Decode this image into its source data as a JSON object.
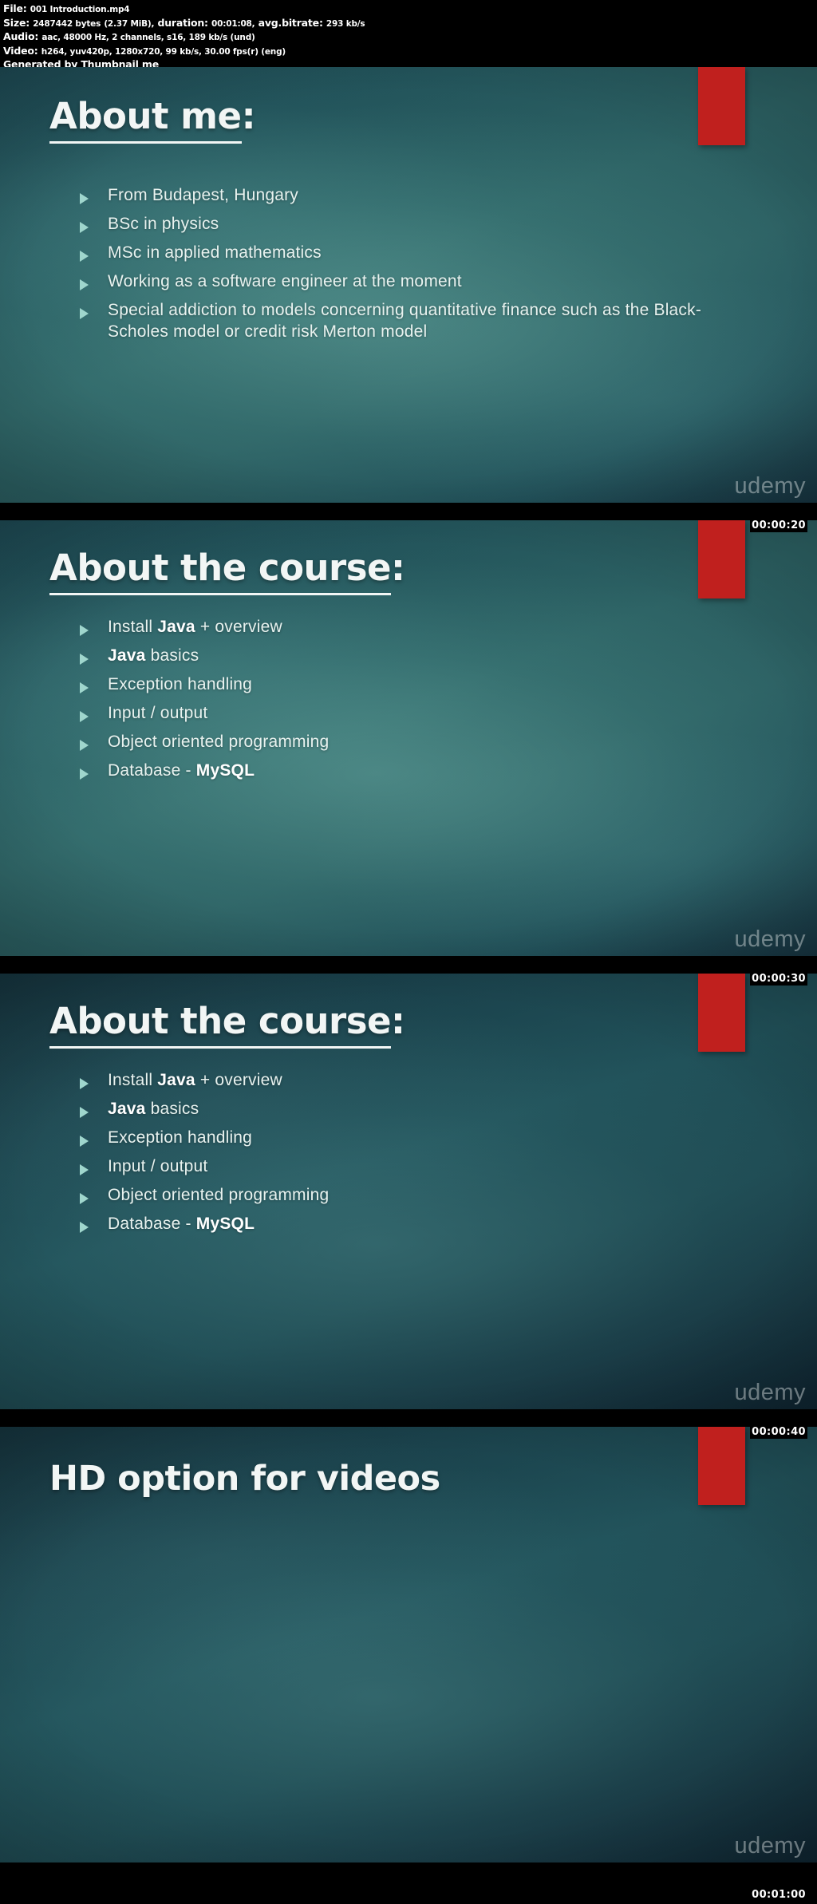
{
  "meta": {
    "file_label": "File:",
    "file_name": "001 Introduction.mp4",
    "size_label": "Size:",
    "size_bytes": "2487442 bytes",
    "size_mib": "(2.37 MiB),",
    "duration_label": "duration:",
    "duration": "00:01:08,",
    "bitrate_label": "avg.bitrate:",
    "bitrate": "293 kb/s",
    "audio_label": "Audio:",
    "audio_info": "aac, 48000 Hz, 2 channels, s16, 189 kb/s (und)",
    "video_label": "Video:",
    "video_info": "h264, yuv420p, 1280x720, 99 kb/s, 30.00 fps(r) (eng)",
    "generator": "Generated by Thumbnail me"
  },
  "watermark": "udemy",
  "slides": [
    {
      "id": "slide-1",
      "title_underlined": "About me",
      "title_suffix": ":",
      "timestamp": "00:00:20",
      "bullets": [
        {
          "text": "From Budapest, Hungary"
        },
        {
          "text": "BSc in physics"
        },
        {
          "text": "MSc in applied mathematics"
        },
        {
          "text": "Working as a software engineer at the moment"
        },
        {
          "text": "Special addiction to models concerning quantitative finance such as the Black-Scholes model or credit risk Merton model"
        }
      ]
    },
    {
      "id": "slide-2",
      "title_underlined": "About the course",
      "title_suffix": ":",
      "timestamp": "00:00:30",
      "bullets": [
        {
          "pre": "Install ",
          "bold": "Java",
          "post": " + overview"
        },
        {
          "bold": "Java",
          "post": " basics"
        },
        {
          "text": "Exception handling"
        },
        {
          "text": "Input / output"
        },
        {
          "text": "Object oriented programming"
        },
        {
          "pre": "Database - ",
          "bold": "MySQL",
          "post": ""
        }
      ]
    },
    {
      "id": "slide-3",
      "title_underlined": "About the course",
      "title_suffix": ":",
      "timestamp": "00:00:40",
      "bullets": [
        {
          "pre": "Install ",
          "bold": "Java",
          "post": " + overview"
        },
        {
          "bold": "Java",
          "post": " basics"
        },
        {
          "text": "Exception handling"
        },
        {
          "text": "Input / output"
        },
        {
          "text": "Object oriented programming"
        },
        {
          "pre": "Database - ",
          "bold": "MySQL",
          "post": ""
        }
      ]
    },
    {
      "id": "slide-4",
      "title_plain": "HD option for videos",
      "timestamp": "00:01:00",
      "bullets": []
    }
  ],
  "colors": {
    "accent_red": "#c0201e",
    "bullet_marker": "#9fd6cd",
    "text": "#e8f2ef",
    "background_teal": "#2c6163"
  }
}
